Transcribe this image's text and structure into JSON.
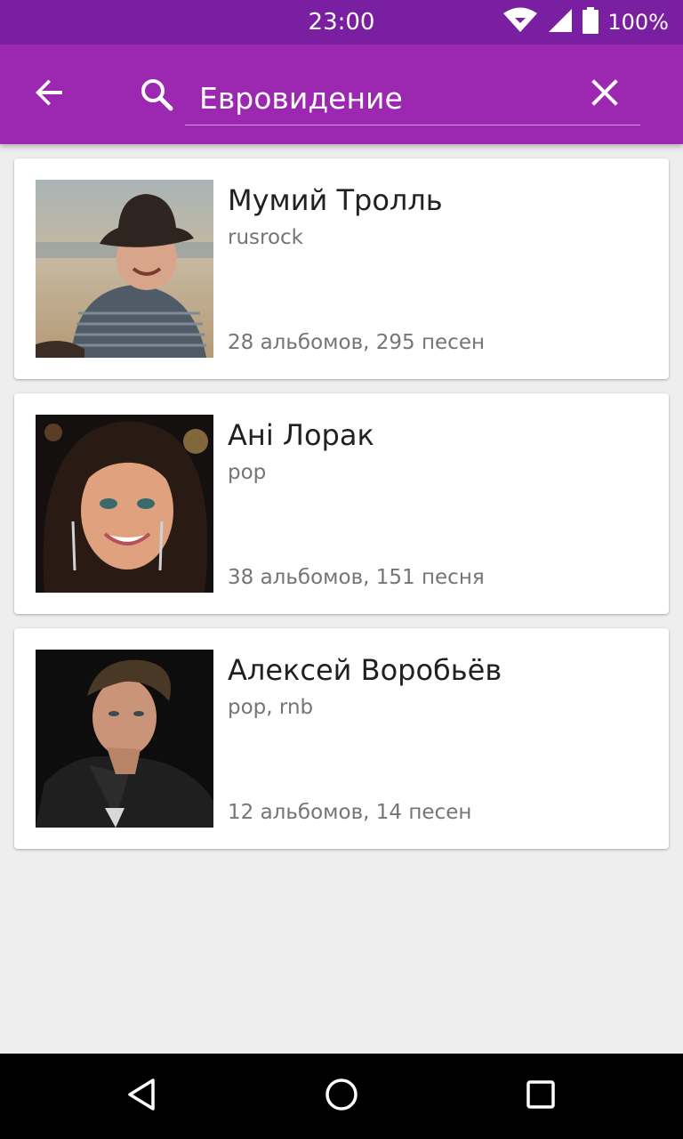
{
  "status_bar": {
    "time": "23:00",
    "battery_percent": "100%",
    "icons": [
      "wifi-icon",
      "signal-icon",
      "battery-icon"
    ]
  },
  "toolbar": {
    "search_value": "Евровидение",
    "icons": [
      "back-arrow-icon",
      "search-icon",
      "close-icon"
    ]
  },
  "results": [
    {
      "name": "Мумий Тролль",
      "genre": "rusrock",
      "stats": "28 альбомов, 295 песен"
    },
    {
      "name": "Ані Лорак",
      "genre": "pop",
      "stats": "38 альбомов, 151 песня"
    },
    {
      "name": "Алексей Воробьёв",
      "genre": "pop, rnb",
      "stats": "12 альбомов, 14 песен"
    }
  ],
  "nav_bar": {
    "icons": [
      "back-triangle-icon",
      "home-circle-icon",
      "recents-square-icon"
    ]
  },
  "colors": {
    "status_bar": "#7b1fa2",
    "toolbar": "#9c27b0",
    "background": "#eeeeee",
    "card": "#ffffff",
    "primary_text": "#212121",
    "secondary_text": "#757575"
  }
}
